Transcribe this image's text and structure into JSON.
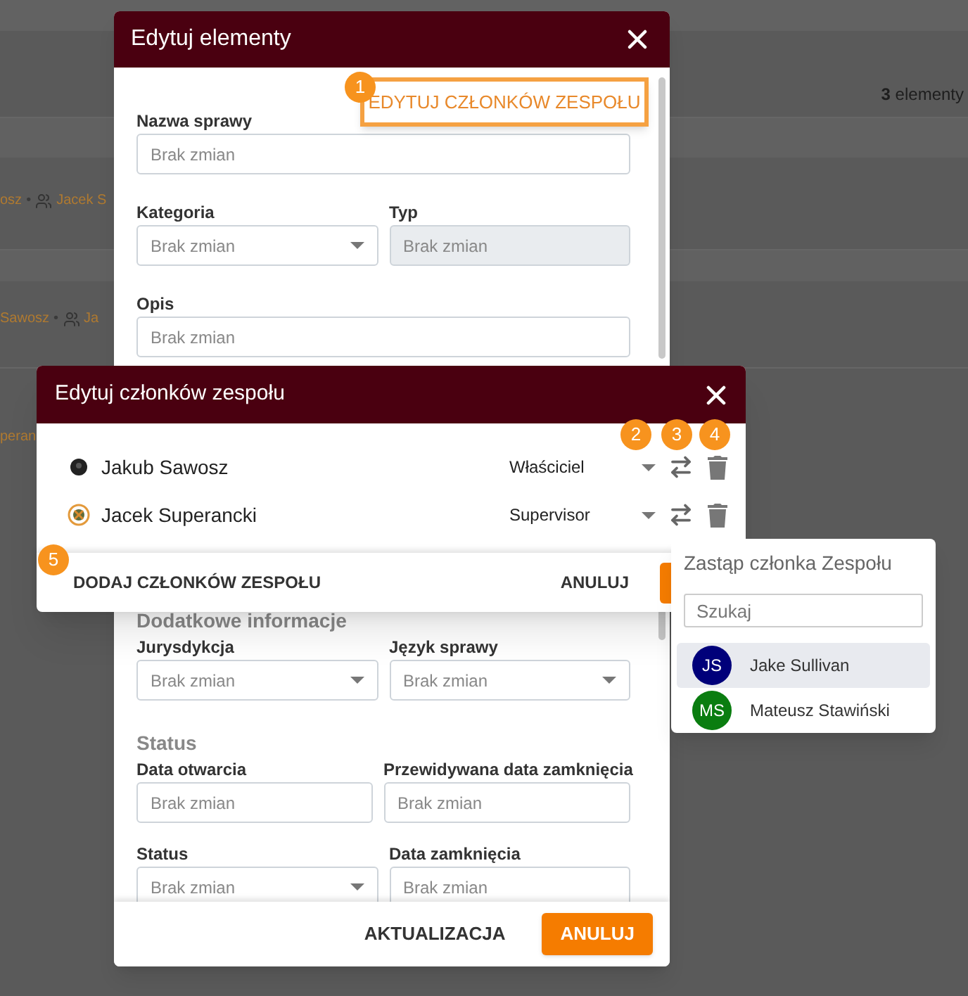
{
  "background": {
    "summary": "**3** elementy",
    "rows": [
      {
        "owner": "osz",
        "separator": "•",
        "member": "Jacek S"
      },
      {
        "owner": "Sawosz",
        "separator": "•",
        "member": "Ja"
      },
      {
        "owner": "peran"
      }
    ]
  },
  "edit_dialog": {
    "title": "Edytuj elementy",
    "team_button": {
      "label": "EDYTUJ CZŁONKÓW ZESPOŁU",
      "callout": "1"
    },
    "rows": [
      [
        {
          "label": "Nazwa sprawy",
          "placeholder": "Brak zmian",
          "kind": "text"
        }
      ],
      [
        {
          "label": "Kategoria",
          "placeholder": "Brak zmian",
          "kind": "select"
        },
        {
          "label": "Typ",
          "placeholder": "Brak zmian",
          "kind": "readonly"
        }
      ],
      [
        {
          "label": "Opis",
          "placeholder": "Brak zmian",
          "kind": "text"
        }
      ]
    ],
    "sections": [
      {
        "heading": "Dodatkowe informacje",
        "rows": [
          [
            {
              "label": "Jurysdykcja",
              "placeholder": "Brak zmian",
              "kind": "select"
            },
            {
              "label": "Język sprawy",
              "placeholder": "Brak zmian",
              "kind": "select"
            }
          ]
        ]
      },
      {
        "heading": "Status",
        "rows": [
          [
            {
              "label": "Data otwarcia",
              "placeholder": "Brak zmian",
              "kind": "text"
            },
            {
              "label": "Przewidywana data zamknięcia",
              "placeholder": "Brak zmian",
              "kind": "text"
            }
          ],
          [
            {
              "label": "Status",
              "placeholder": "Brak zmian",
              "kind": "select"
            },
            {
              "label": "Data zamknięcia",
              "placeholder": "Brak zmian",
              "kind": "text"
            }
          ]
        ]
      }
    ],
    "buttons": [
      {
        "label": "AKTUALIZACJA",
        "kind": "text"
      },
      {
        "label": "ANULUJ",
        "kind": "primary"
      }
    ]
  },
  "team_dialog": {
    "title": "Edytuj członków zespołu",
    "callouts": [
      "2",
      "3",
      "4"
    ],
    "members": [
      {
        "name": "Jakub Sawosz",
        "role": "Właściciel",
        "avatar": {
          "kind": "dark"
        }
      },
      {
        "name": "Jacek Superancki",
        "role": "Supervisor",
        "avatar": {
          "kind": "ring"
        }
      }
    ],
    "add_button": {
      "label": "DODAJ CZŁONKÓW ZESPOŁU",
      "callout": "5"
    },
    "cancel_button": "ANULUJ"
  },
  "replace_popover": {
    "title": "Zastąp członka Zespołu",
    "search": {
      "placeholder": "Szukaj"
    },
    "people": [
      {
        "initials": "JS",
        "name": "Jake Sullivan",
        "color": "#00007a",
        "selected": true
      },
      {
        "initials": "MS",
        "name": "Mateusz Stawiński",
        "color": "#0a7d10",
        "selected": false
      }
    ]
  }
}
